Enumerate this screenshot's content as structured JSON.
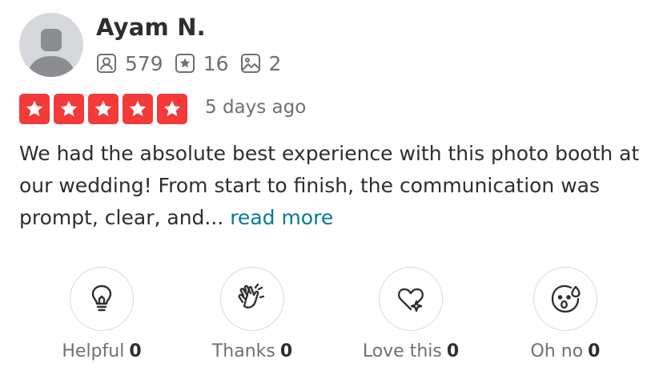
{
  "user": {
    "name": "Ayam N.",
    "stats": [
      {
        "icon": "friends-icon",
        "value": "579"
      },
      {
        "icon": "reviews-icon",
        "value": "16"
      },
      {
        "icon": "photos-icon",
        "value": "2"
      }
    ]
  },
  "rating": {
    "stars": 5,
    "max": 5,
    "color": "#f43939"
  },
  "date": "5 days ago",
  "review": {
    "text": "We had the absolute best experience with this photo booth at our wedding! From start to finish, the communication was prompt, clear, and... ",
    "read_more": "read more"
  },
  "reactions": [
    {
      "icon": "lightbulb-icon",
      "label": "Helpful",
      "count": "0"
    },
    {
      "icon": "clapping-hands-icon",
      "label": "Thanks",
      "count": "0"
    },
    {
      "icon": "heart-sparkle-icon",
      "label": "Love this",
      "count": "0"
    },
    {
      "icon": "shocked-face-icon",
      "label": "Oh no",
      "count": "0"
    }
  ],
  "colors": {
    "link": "#027a97",
    "star_bg": "#f43939",
    "text": "#2d2e2f",
    "muted": "#6e7072"
  }
}
